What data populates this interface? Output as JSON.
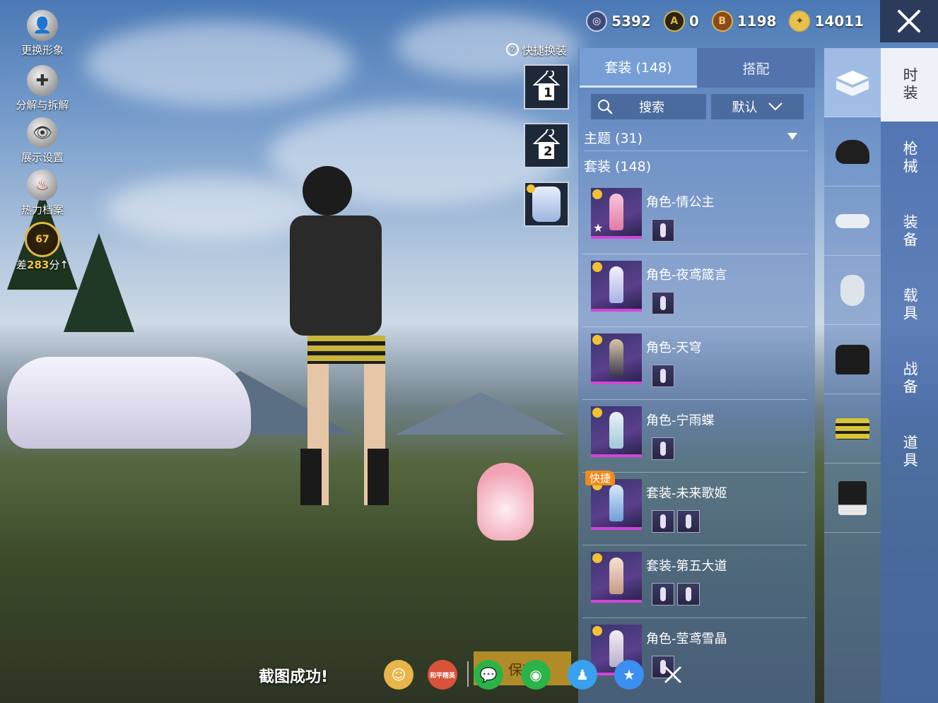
{
  "left_menu": {
    "change_avatar": "更换形象",
    "disassemble": "分解与拆解",
    "display_settings": "展示设置",
    "heat_archive": "热力档案",
    "rank_level": "67",
    "rank_prefix": "差",
    "rank_points": "283",
    "rank_suffix": "分"
  },
  "currencies": [
    {
      "icon": "uc-coin-icon",
      "value": "5392"
    },
    {
      "icon": "ag-coin-icon",
      "value": "0"
    },
    {
      "icon": "bp-coin-icon",
      "value": "1198"
    },
    {
      "icon": "ticket-coin-icon",
      "value": "14011"
    }
  ],
  "quick_outfit": {
    "title": "快捷换装",
    "slot1": "1",
    "slot2": "2"
  },
  "panel": {
    "tabs": {
      "suits": "套装 (148)",
      "match": "搭配"
    },
    "search_label": "搜索",
    "sort_label": "默认",
    "theme_section": "主题 (31)",
    "suit_section": "套装 (148)",
    "fast_badge": "快捷",
    "items": [
      {
        "name": "角色-情公主"
      },
      {
        "name": "角色-夜鸢箴言"
      },
      {
        "name": "角色-天穹"
      },
      {
        "name": "角色-宁雨蝶"
      },
      {
        "name": "套装-未来歌姬"
      },
      {
        "name": "套装-第五大道"
      },
      {
        "name": "角色-莹鸢雪晶"
      }
    ]
  },
  "main_tabs": [
    "时装",
    "枪械",
    "装备",
    "载具",
    "战备",
    "道具"
  ],
  "bottom": {
    "toast": "截图成功!",
    "save_label": "保存",
    "peace_elite_label": "和平精英"
  },
  "colors": {
    "accent_gold": "#f2c53d",
    "rarity_purple": "#d444d8",
    "fast_badge": "#f08a1c"
  }
}
